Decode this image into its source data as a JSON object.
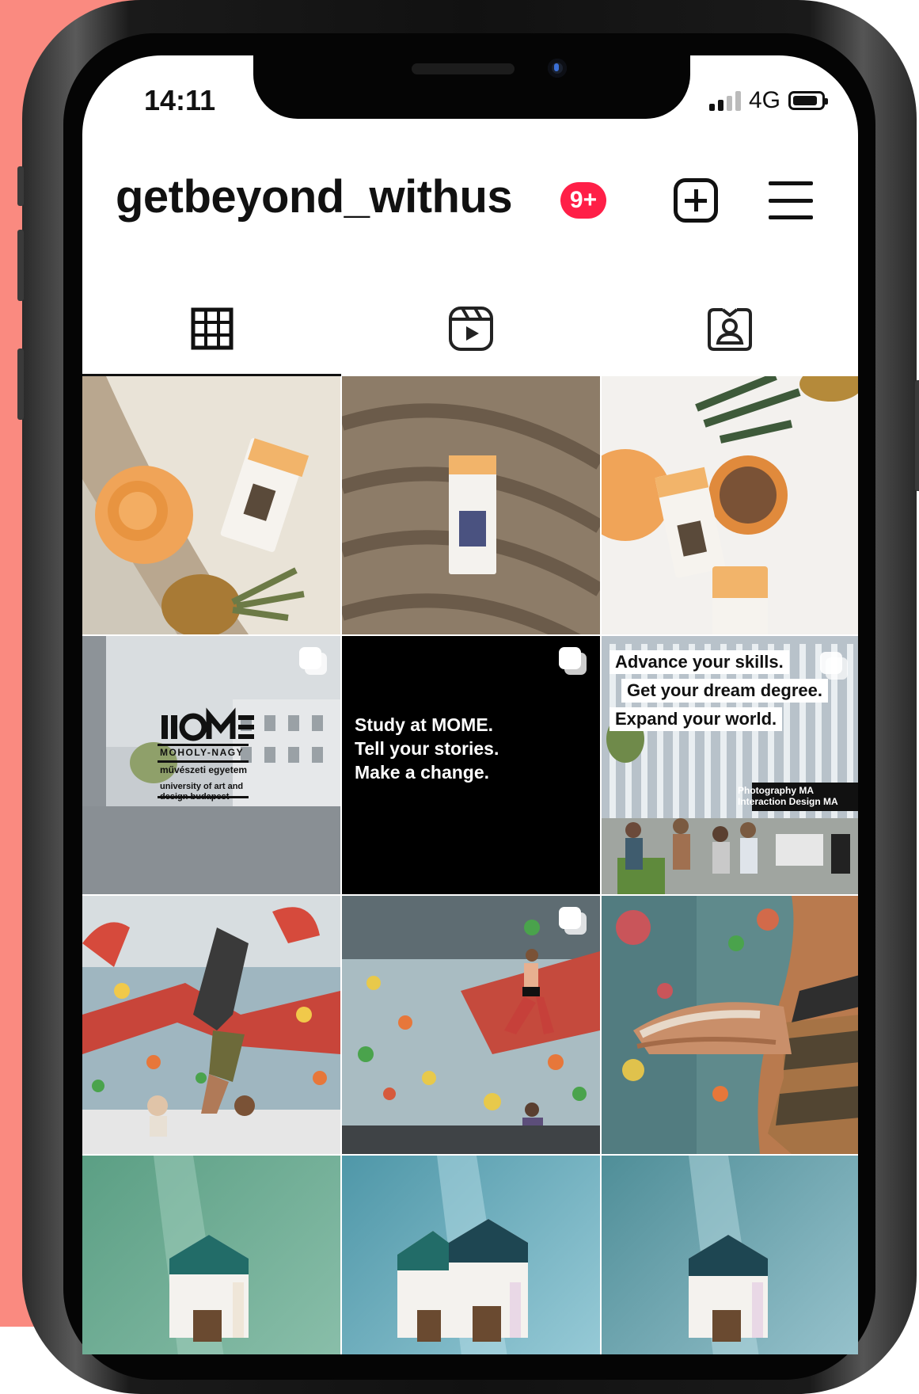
{
  "status_bar": {
    "time": "14:11",
    "network": "4G"
  },
  "profile": {
    "username": "getbeyond_withus",
    "notifications_badge": "9+"
  },
  "tabs": [
    {
      "name": "posts",
      "icon": "grid-icon"
    },
    {
      "name": "reels",
      "icon": "reels-icon"
    },
    {
      "name": "tagged",
      "icon": "tagged-user-icon"
    }
  ],
  "posts": {
    "mome_logo": {
      "line1": "MOHOLY-NAGY",
      "line2": "művészeti egyetem",
      "line3": "university of art and",
      "line4": "design budapest"
    },
    "mome_text": {
      "line1": "Study at MOME.",
      "line2": "Tell your stories.",
      "line3": "Make a change."
    },
    "degree": {
      "line1": "Advance your skills.",
      "line2": "Get your dream degree.",
      "line3": "Expand your world.",
      "program1": "Photography MA",
      "program2": "Interaction Design MA"
    }
  }
}
